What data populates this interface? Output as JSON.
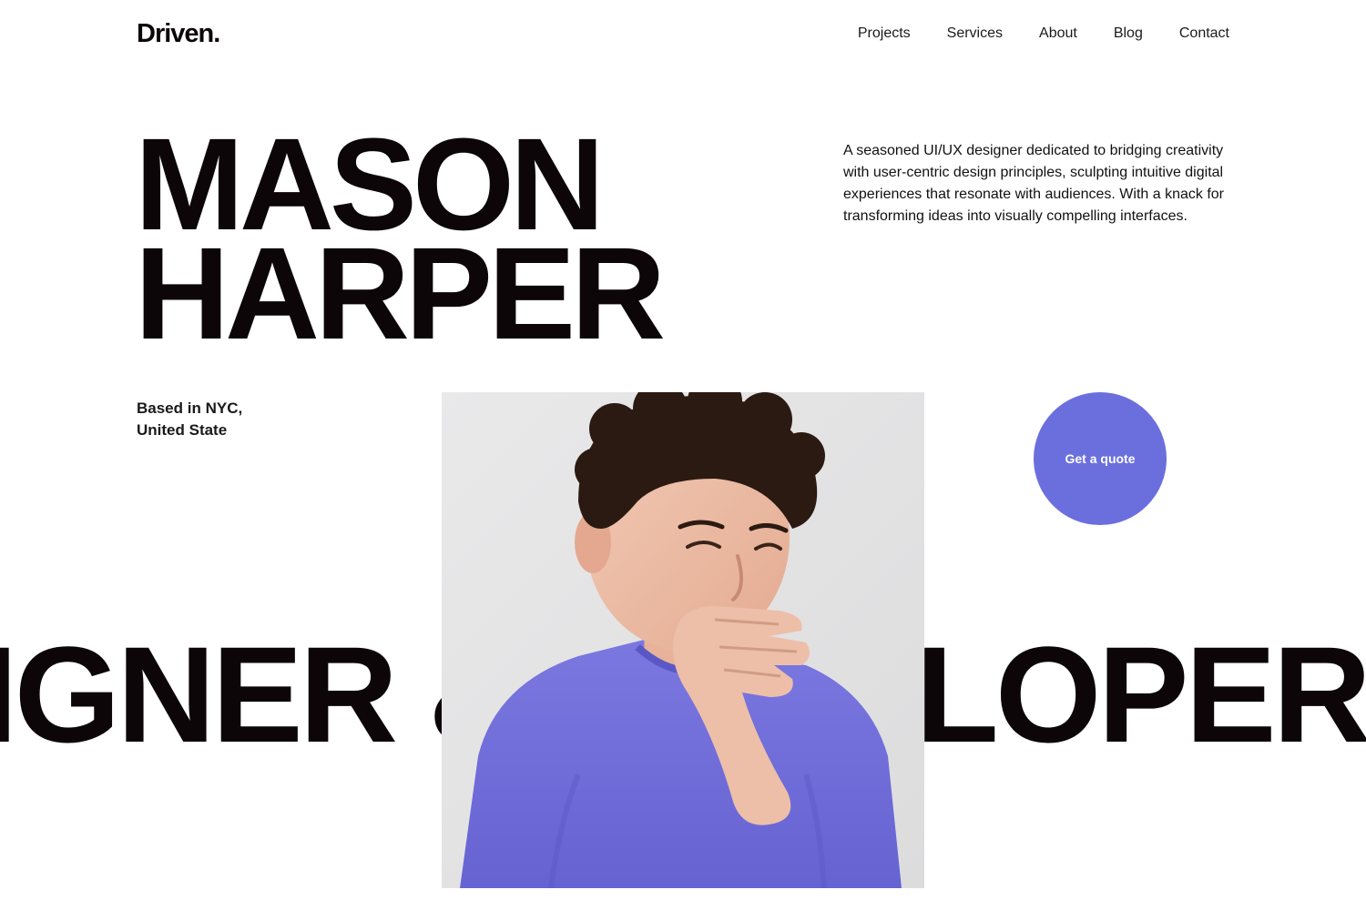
{
  "header": {
    "logo": "Driven.",
    "nav": [
      "Projects",
      "Services",
      "About",
      "Blog",
      "Contact"
    ]
  },
  "hero": {
    "name_line1": "MASON",
    "name_line2": "HARPER",
    "description": "A seasoned UI/UX designer dedicated to bridging creativity with user-centric design principles, sculpting intuitive digital experiences that resonate with audiences. With a knack for transforming ideas into visually compelling interfaces.",
    "location_line1": "Based in NYC,",
    "location_line2": "United State",
    "cta_label": "Get a quote",
    "marquee": "IGNER & DEVELOPER D"
  },
  "colors": {
    "accent": "#6b6fdd",
    "text": "#0c0609",
    "portrait_bg": "#e5e5e6",
    "shirt": "#6c6ad6"
  },
  "images": {
    "portrait": "smiling young man with curly dark hair in a purple t-shirt, hand raised to mouth"
  }
}
